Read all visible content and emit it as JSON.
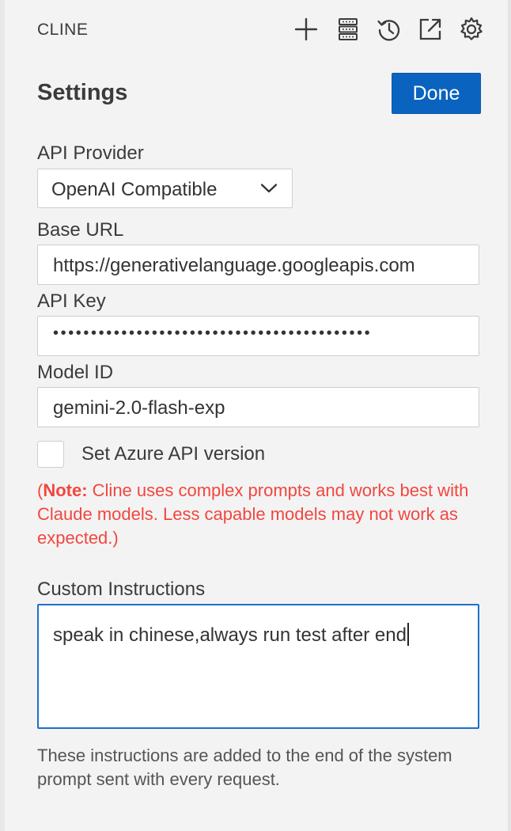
{
  "header": {
    "title": "CLINE",
    "icons": [
      "plus-icon",
      "server-icon",
      "history-icon",
      "popout-icon",
      "gear-icon"
    ]
  },
  "settings": {
    "title": "Settings",
    "done_label": "Done"
  },
  "api_provider": {
    "label": "API Provider",
    "value": "OpenAI Compatible"
  },
  "base_url": {
    "label": "Base URL",
    "value": "https://generativelanguage.googleapis.com"
  },
  "api_key": {
    "label": "API Key",
    "masked_value": "••••••••••••••••••••••••••••••••••••••••••"
  },
  "model_id": {
    "label": "Model ID",
    "value": "gemini-2.0-flash-exp"
  },
  "azure_version": {
    "label": "Set Azure API version",
    "checked": false
  },
  "warning": {
    "prefix": "(",
    "note_label": "Note:",
    "text": " Cline uses complex prompts and works best with Claude models. Less capable models may not work as expected.)"
  },
  "custom_instructions": {
    "label": "Custom Instructions",
    "value": "speak in chinese,always run test after end",
    "help": "These instructions are added to the end of the system prompt sent with every request."
  },
  "colors": {
    "accent": "#0a63bf",
    "warning": "#f1473f",
    "focus_border": "#1f6fcb",
    "background": "#f3f3f3"
  }
}
